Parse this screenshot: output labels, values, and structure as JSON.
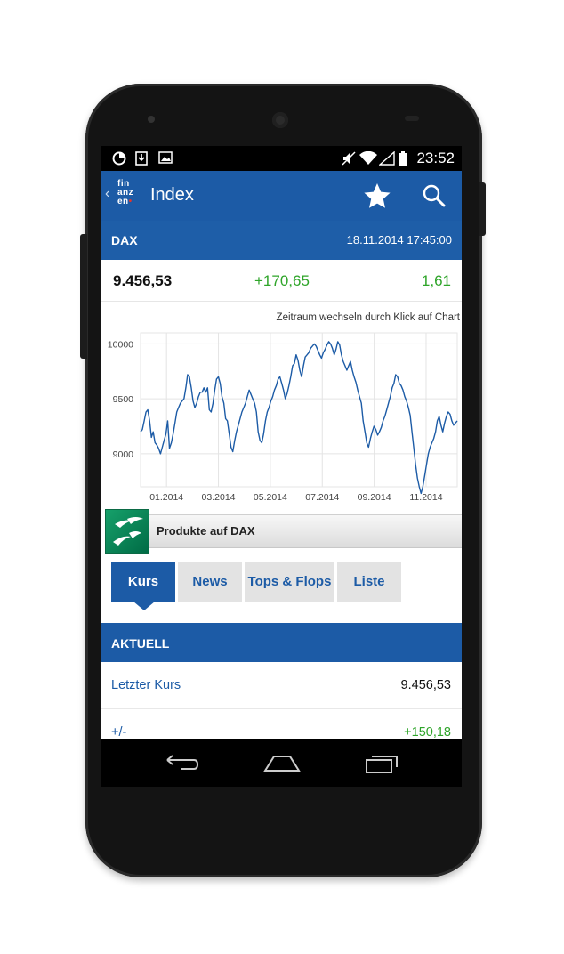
{
  "status_bar": {
    "time": "23:52"
  },
  "app_bar": {
    "back_glyph": "‹",
    "logo_lines": [
      "fin",
      "anz",
      "en"
    ],
    "title": "Index"
  },
  "instrument": {
    "name": "DAX",
    "datetime": "18.11.2014 17:45:00",
    "price": "9.456,53",
    "change": "+170,65",
    "change_pct": "1,61"
  },
  "chart_hint": "Zeitraum wechseln durch Klick auf Chart",
  "chart_data": {
    "type": "line",
    "title": "",
    "xlabel": "",
    "ylabel": "",
    "ylim": [
      8700,
      10100
    ],
    "yticks": [
      9000,
      9500,
      10000
    ],
    "ytick_labels": [
      "9000",
      "9500",
      "10000"
    ],
    "xticks": [
      "01.2014",
      "03.2014",
      "05.2014",
      "07.2014",
      "09.2014",
      "11.2014"
    ],
    "xtick_positions": [
      1,
      3,
      5,
      7,
      9,
      11
    ],
    "xlim": [
      0,
      12.2
    ],
    "grid": true,
    "series": [
      {
        "values": [
          9200,
          9220,
          9300,
          9380,
          9400,
          9300,
          9150,
          9200,
          9100,
          9080,
          9050,
          9000,
          9060,
          9120,
          9180,
          9300,
          9050,
          9100,
          9180,
          9280,
          9380,
          9420,
          9460,
          9480,
          9500,
          9600,
          9720,
          9700,
          9600,
          9480,
          9420,
          9460,
          9520,
          9560,
          9560,
          9600,
          9560,
          9600,
          9400,
          9380,
          9460,
          9580,
          9680,
          9700,
          9640,
          9520,
          9460,
          9320,
          9300,
          9180,
          9060,
          9020,
          9120,
          9200,
          9260,
          9320,
          9380,
          9420,
          9460,
          9520,
          9580,
          9540,
          9500,
          9460,
          9380,
          9200,
          9120,
          9100,
          9180,
          9300,
          9380,
          9420,
          9480,
          9520,
          9580,
          9620,
          9680,
          9700,
          9640,
          9580,
          9500,
          9550,
          9620,
          9700,
          9800,
          9820,
          9900,
          9850,
          9760,
          9700,
          9800,
          9880,
          9900,
          9920,
          9960,
          9980,
          10000,
          9980,
          9940,
          9900,
          9870,
          9920,
          9950,
          9990,
          10020,
          10000,
          9960,
          9900,
          9950,
          10020,
          9990,
          9900,
          9840,
          9800,
          9760,
          9800,
          9840,
          9760,
          9700,
          9650,
          9580,
          9520,
          9460,
          9300,
          9200,
          9100,
          9060,
          9140,
          9200,
          9250,
          9220,
          9170,
          9200,
          9240,
          9300,
          9340,
          9400,
          9460,
          9520,
          9600,
          9640,
          9720,
          9700,
          9640,
          9620,
          9580,
          9520,
          9480,
          9420,
          9350,
          9200,
          9050,
          8900,
          8780,
          8700,
          8640,
          8700,
          8800,
          8900,
          9000,
          9060,
          9100,
          9140,
          9200,
          9300,
          9340,
          9260,
          9200,
          9280,
          9340,
          9380,
          9360,
          9300,
          9260,
          9280,
          9300
        ],
        "x_start": 0,
        "x_end": 12.2
      }
    ],
    "line_color": "#1c5ba6"
  },
  "promo": {
    "text": "Produkte auf DAX"
  },
  "tabs": [
    {
      "label": "Kurs"
    },
    {
      "label": "News"
    },
    {
      "label": "Tops & Flops"
    },
    {
      "label": "Liste"
    }
  ],
  "section_title": "AKTUELL",
  "rows": [
    {
      "label": "Letzter Kurs",
      "value": "9.456,53",
      "value_color": "#111111"
    },
    {
      "label": "+/-",
      "value": "+150,18",
      "value_color": "#2fa52a"
    }
  ],
  "colors": {
    "primary": "#1c5ba6",
    "positive": "#2fa52a",
    "tab_inactive": "#e3e3e3"
  }
}
